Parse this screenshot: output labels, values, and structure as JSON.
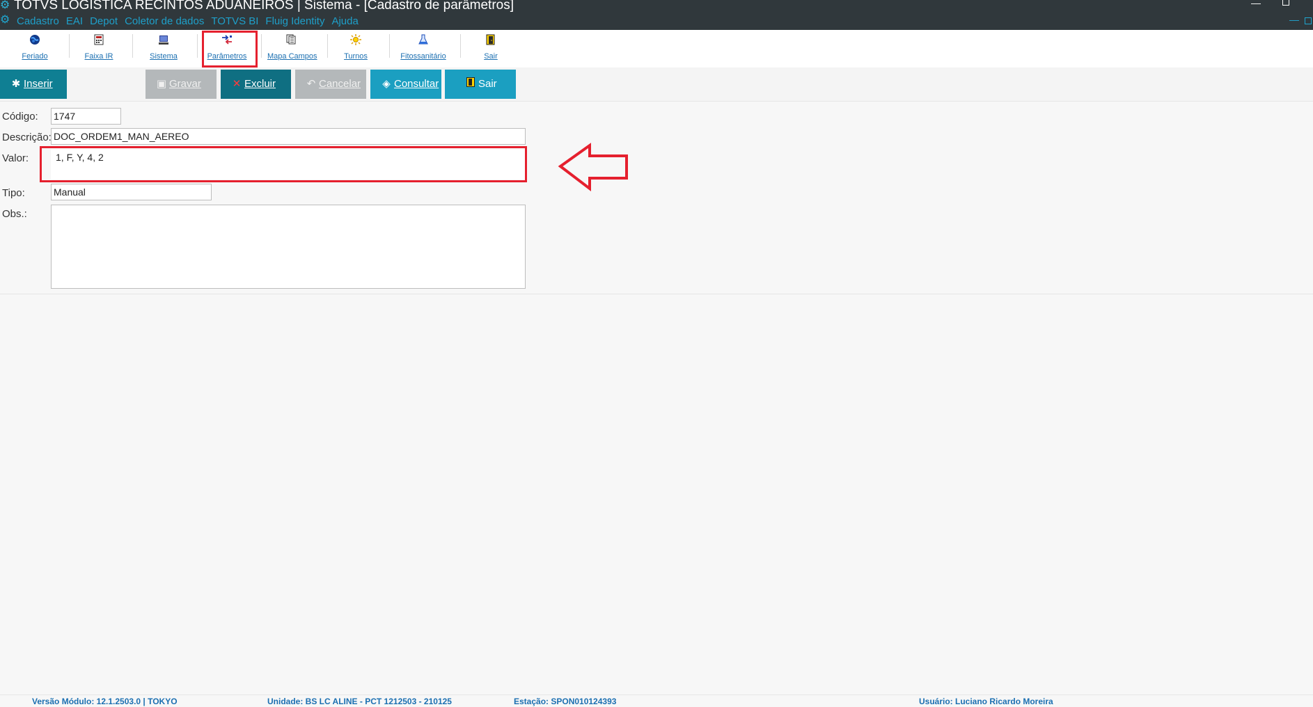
{
  "window": {
    "title": "TOTVS LOGISTICA RECINTOS ADUANEIROS | Sistema - [Cadastro de parâmetros]"
  },
  "menu": {
    "items": [
      "Cadastro",
      "EAI",
      "Depot",
      "Coletor de dados",
      "TOTVS BI",
      "Fluig Identity",
      "Ajuda"
    ]
  },
  "toolbar": {
    "items": [
      {
        "label": "Feriado",
        "icon": "globe-icon"
      },
      {
        "label": "Faixa IR",
        "icon": "calculator-icon"
      },
      {
        "label": "Sistema",
        "icon": "computer-icon"
      },
      {
        "label": "Parâmetros",
        "icon": "parameters-icon"
      },
      {
        "label": "Mapa Campos",
        "icon": "map-fields-icon"
      },
      {
        "label": "Turnos",
        "icon": "sun-icon"
      },
      {
        "label": "Fitossanitário",
        "icon": "flask-icon"
      },
      {
        "label": "Sair",
        "icon": "exit-door-icon"
      }
    ]
  },
  "actions": {
    "insert": "Inserir",
    "save": "Gravar",
    "delete": "Excluir",
    "cancel": "Cancelar",
    "query": "Consultar",
    "exit": "Sair"
  },
  "form": {
    "codigo_label": "Código:",
    "codigo_value": "1747",
    "descricao_label": "Descrição:",
    "descricao_value": "DOC_ORDEM1_MAN_AEREO",
    "valor_label": "Valor:",
    "valor_value": "1, F, Y, 4, 2",
    "tipo_label": "Tipo:",
    "tipo_value": "Manual",
    "obs_label": "Obs.:",
    "obs_value": ""
  },
  "status": {
    "version": "Versão Módulo:  12.1.2503.0  |  TOKYO",
    "unit": "Unidade: BS LC ALINE - PCT 1212503 - 210125",
    "station": "Estação: SPON010124393",
    "user": "Usuário: Luciano Ricardo Moreira"
  },
  "colors": {
    "annotation": "#e5202e",
    "titlebar": "#30383c",
    "menu_text": "#1e9fc9",
    "primary_button": "#0f7f93",
    "secondary_button": "#1b9fc1",
    "disabled_button": "#b4b8ba"
  }
}
